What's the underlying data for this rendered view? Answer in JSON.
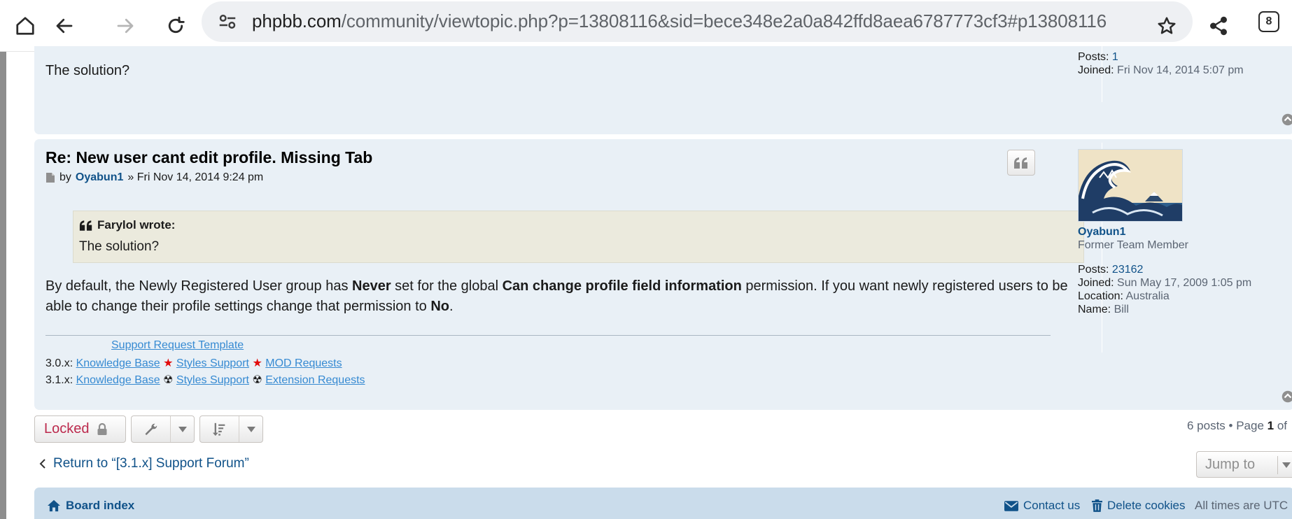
{
  "browser": {
    "url_host": "phpbb.com",
    "url_path": "/community/viewtopic.php?p=13808116&sid=bece348e2a0a842ffd8aea6787773cf3#p13808116",
    "tab_count": "8"
  },
  "previous_post": {
    "text": "The solution?",
    "posts_label": "Posts:",
    "posts_value": "1",
    "joined_label": "Joined:",
    "joined_value": "Fri Nov 14, 2014 5:07 pm"
  },
  "post": {
    "title": "Re: New user cant edit profile. Missing Tab",
    "by_label": "by",
    "author": "Oyabun1",
    "date": "» Fri Nov 14, 2014 9:24 pm",
    "quote": {
      "cite": "Farylol wrote:",
      "text": "The solution?"
    },
    "content": {
      "p1": "By default, the Newly Registered User group has ",
      "b1": "Never",
      "p2": " set for the global ",
      "b2": "Can change profile field information",
      "p3": " permission. If you want newly registered users to be able to change their profile settings change that permission to ",
      "b3": "No",
      "p4": "."
    },
    "signature": {
      "template_link": "Support Request Template",
      "line1_prefix": "3.0.x: ",
      "line1_links": [
        "Knowledge Base",
        "Styles Support",
        "MOD Requests"
      ],
      "line2_prefix": "3.1.x: ",
      "line2_links": [
        "Knowledge Base",
        "Styles Support",
        "Extension Requests"
      ],
      "star": "★",
      "radiation": "☢"
    }
  },
  "profile": {
    "username": "Oyabun1",
    "rank": "Former Team Member",
    "posts_label": "Posts:",
    "posts_value": "23162",
    "joined_label": "Joined:",
    "joined_value": "Sun May 17, 2009 1:05 pm",
    "location_label": "Location:",
    "location_value": "Australia",
    "name_label": "Name:",
    "name_value": "Bill"
  },
  "actions": {
    "locked_label": "Locked",
    "pagination_prefix": "6 posts • Page ",
    "pagination_page": "1",
    "pagination_suffix": " of",
    "return_link": "Return to “[3.1.x] Support Forum”",
    "jump_to": "Jump to"
  },
  "footer": {
    "board_index": "Board index",
    "contact_us": "Contact us",
    "delete_cookies": "Delete cookies",
    "timezone": "All times are UTC"
  },
  "colors": {
    "link": "#105289",
    "post_bg": "#e9f0f6",
    "quote_bg": "#ebeadd",
    "locked": "#bc2a4d",
    "footer_bg": "#cadceb"
  }
}
